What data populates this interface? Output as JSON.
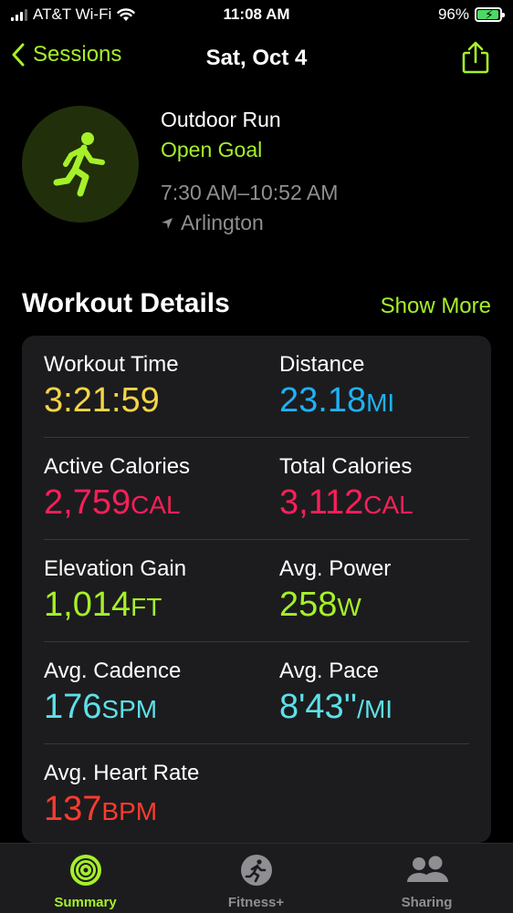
{
  "status_bar": {
    "carrier": "AT&T Wi-Fi",
    "time": "11:08 AM",
    "battery": "96%",
    "battery_level": 0.96
  },
  "nav": {
    "back_label": "Sessions",
    "title": "Sat, Oct 4"
  },
  "workout": {
    "title": "Outdoor Run",
    "goal": "Open Goal",
    "time_range": "7:30 AM–10:52 AM",
    "location": "Arlington"
  },
  "details": {
    "title": "Workout Details",
    "show_more": "Show More",
    "metrics": [
      {
        "label": "Workout Time",
        "value": "3:21:59",
        "unit": "",
        "color": "#f5d547"
      },
      {
        "label": "Distance",
        "value": "23.18",
        "unit": "MI",
        "color": "#1fb1f5"
      },
      {
        "label": "Active Calories",
        "value": "2,759",
        "unit": "CAL",
        "color": "#fa1f59"
      },
      {
        "label": "Total Calories",
        "value": "3,112",
        "unit": "CAL",
        "color": "#fa1f59"
      },
      {
        "label": "Elevation Gain",
        "value": "1,014",
        "unit": "FT",
        "color": "#a6f029"
      },
      {
        "label": "Avg. Power",
        "value": "258",
        "unit": "W",
        "color": "#a6f029"
      },
      {
        "label": "Avg. Cadence",
        "value": "176",
        "unit": "SPM",
        "color": "#5ee0e8"
      },
      {
        "label": "Avg. Pace",
        "value": "8'43''",
        "unit": "/MI",
        "color": "#5ee0e8"
      },
      {
        "label": "Avg. Heart Rate",
        "value": "137",
        "unit": "BPM",
        "color": "#ff3b2f"
      }
    ]
  },
  "tabs": [
    {
      "label": "Summary",
      "active": true,
      "icon": "summary-rings-icon"
    },
    {
      "label": "Fitness+",
      "active": false,
      "icon": "fitness-plus-icon"
    },
    {
      "label": "Sharing",
      "active": false,
      "icon": "sharing-people-icon"
    }
  ],
  "colors": {
    "accent": "#a6f029",
    "inactive": "#8e8e93"
  }
}
